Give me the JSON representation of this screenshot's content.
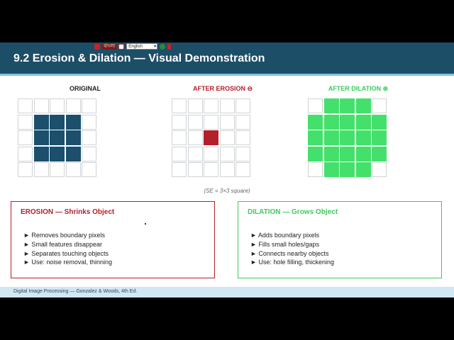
{
  "toolbar": {
    "bangla_label": "বাংলা",
    "language_select": "English"
  },
  "slide": {
    "title": "9.2 Erosion & Dilation — Visual Demonstration",
    "footer": "Digital Image Processing — Gonzalez & Woods, 4th Ed.",
    "se_note": "(SE = 3×3 square)"
  },
  "grids": [
    {
      "label": "ORIGINAL",
      "label_color": "#222222",
      "fill_color": "#1b4f6c",
      "cells": [
        [
          0,
          0,
          0,
          0,
          0
        ],
        [
          0,
          1,
          1,
          1,
          0
        ],
        [
          0,
          1,
          1,
          1,
          0
        ],
        [
          0,
          1,
          1,
          1,
          0
        ],
        [
          0,
          0,
          0,
          0,
          0
        ]
      ]
    },
    {
      "label": "AFTER EROSION ⊖",
      "label_color": "#b3202a",
      "fill_color": "#b3202a",
      "cells": [
        [
          0,
          0,
          0,
          0,
          0
        ],
        [
          0,
          0,
          0,
          0,
          0
        ],
        [
          0,
          0,
          1,
          0,
          0
        ],
        [
          0,
          0,
          0,
          0,
          0
        ],
        [
          0,
          0,
          0,
          0,
          0
        ]
      ]
    },
    {
      "label": "AFTER DILATION ⊕",
      "label_color": "#3ccb5c",
      "fill_color": "#43e06b",
      "cells": [
        [
          0,
          1,
          1,
          1,
          0
        ],
        [
          1,
          1,
          1,
          1,
          1
        ],
        [
          1,
          1,
          1,
          1,
          1
        ],
        [
          1,
          1,
          1,
          1,
          1
        ],
        [
          0,
          1,
          1,
          1,
          0
        ]
      ]
    }
  ],
  "erosion_box": {
    "heading": "EROSION — Shrinks Object",
    "color": "#b3202a",
    "items": [
      "► Removes boundary pixels",
      "► Small features disappear",
      "► Separates touching objects",
      "► Use: noise removal, thinning"
    ]
  },
  "dilation_box": {
    "heading": "DILATION — Grows Object",
    "color": "#3ccb5c",
    "items": [
      "► Adds boundary pixels",
      "► Fills small holes/gaps",
      "► Connects nearby objects",
      "► Use: hole filling, thickening"
    ]
  }
}
